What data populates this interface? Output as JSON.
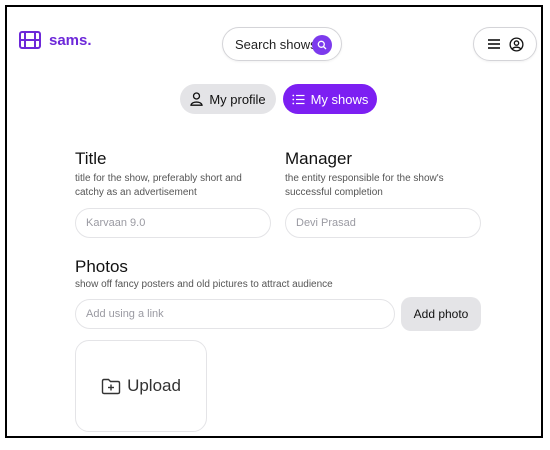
{
  "header": {
    "logo_text": "sams.",
    "search_label": "Search shows"
  },
  "tabs": [
    {
      "label": "My profile",
      "icon": "user-icon",
      "active": false
    },
    {
      "label": "My shows",
      "icon": "list-icon",
      "active": true
    }
  ],
  "form": {
    "title": {
      "label": "Title",
      "description": "title for the show, preferably short and catchy as an advertisement",
      "placeholder": "Karvaan 9.0"
    },
    "manager": {
      "label": "Manager",
      "description": "the entity responsible for the show's successful completion",
      "placeholder": "Devi Prasad"
    },
    "photos": {
      "label": "Photos",
      "description": "show off fancy posters and old pictures to attract audience",
      "link_placeholder": "Add using a link",
      "add_button": "Add photo",
      "upload_label": "Upload"
    }
  },
  "colors": {
    "accent": "#7c1ff2",
    "pill_bg": "#e4e4e7",
    "border": "#e4e4e7"
  }
}
